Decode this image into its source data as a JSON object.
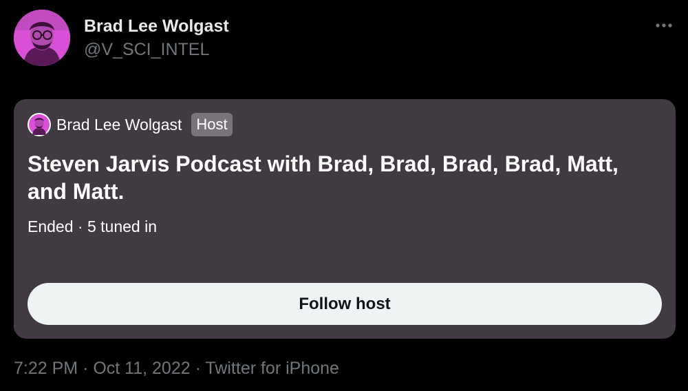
{
  "author": {
    "name": "Brad Lee Wolgast",
    "handle": "@V_SCI_INTEL",
    "avatar_color": "#d94fd6"
  },
  "space_card": {
    "background_color": "#423a42",
    "host_name": "Brad Lee Wolgast",
    "host_badge": "Host",
    "title": "Steven Jarvis Podcast with Brad, Brad, Brad, Brad, Matt, and Matt.",
    "status": "Ended",
    "separator": "·",
    "listeners": "5 tuned in",
    "follow_button_label": "Follow host"
  },
  "meta": {
    "time": "7:22 PM",
    "separator": "·",
    "date": "Oct 11, 2022",
    "source": "Twitter for iPhone"
  },
  "icons": {
    "more": "more-horizontal-icon"
  }
}
